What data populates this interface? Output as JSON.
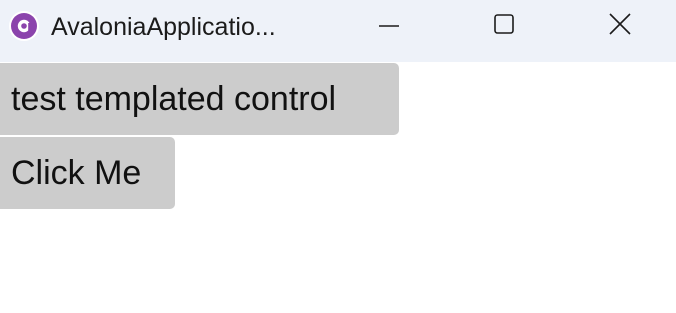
{
  "window": {
    "title": "AvaloniaApplicatio...",
    "app_icon": "avalonia-logo-icon",
    "controls": {
      "minimize_icon": "minimize-icon",
      "maximize_icon": "maximize-icon",
      "close_icon": "close-icon"
    },
    "colors": {
      "titlebar_bg": "#eef2f9",
      "logo_purple": "#8b44ac"
    }
  },
  "content": {
    "templated_control_label": "test templated control",
    "click_button_label": "Click Me",
    "button_bg": "#cccccc"
  }
}
